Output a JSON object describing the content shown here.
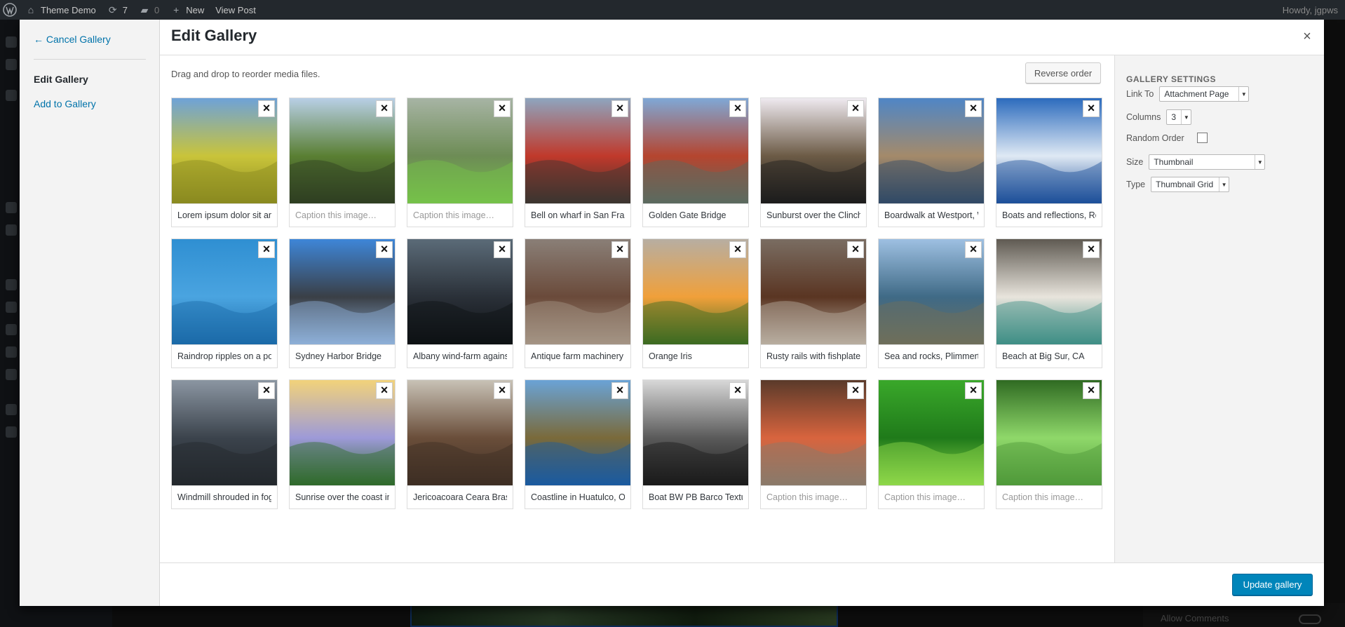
{
  "adminbar": {
    "site_name": "Theme Demo",
    "updates_count": "7",
    "comments_count": "0",
    "new_label": "New",
    "view_post_label": "View Post",
    "howdy": "Howdy, jgpws"
  },
  "background": {
    "allow_comments_label": "Allow Comments"
  },
  "menu": {
    "cancel_label": "← Cancel Gallery",
    "edit_gallery_label": "Edit Gallery",
    "add_to_gallery_label": "Add to Gallery"
  },
  "header": {
    "title": "Edit Gallery",
    "close_label": "×"
  },
  "toolbar": {
    "hint": "Drag and drop to reorder media files.",
    "reverse_label": "Reverse order"
  },
  "caption_placeholder": "Caption this image…",
  "items": [
    {
      "caption": "Lorem ipsum dolor sit amet",
      "colors": [
        "#6ea2d8",
        "#c9c43a",
        "#8a8a20"
      ]
    },
    {
      "caption": "",
      "colors": [
        "#b8cfe6",
        "#5a7f33",
        "#2f3f22"
      ]
    },
    {
      "caption": "",
      "colors": [
        "#a7b4a4",
        "#6d8c55",
        "#76c24a"
      ]
    },
    {
      "caption": "Bell on wharf in San Francisco",
      "colors": [
        "#8ea5bf",
        "#c0392b",
        "#3b3530"
      ]
    },
    {
      "caption": "Golden Gate Bridge",
      "colors": [
        "#7fa8d6",
        "#b5452f",
        "#5b6b60"
      ]
    },
    {
      "caption": "Sunburst over the Clinch River",
      "colors": [
        "#efeaf0",
        "#6c5b46",
        "#1c1c1c"
      ]
    },
    {
      "caption": "Boardwalk at Westport, WA",
      "colors": [
        "#4f86c6",
        "#a48a6a",
        "#304a66"
      ]
    },
    {
      "caption": "Boats and reflections, Royal Quays",
      "colors": [
        "#2c6bbd",
        "#dfe9f4",
        "#1d4f9a"
      ]
    },
    {
      "caption": "Raindrop ripples on a pond",
      "colors": [
        "#2f8fd2",
        "#4aa4e0",
        "#1b6aa8"
      ]
    },
    {
      "caption": "Sydney Harbor Bridge",
      "colors": [
        "#3e86d8",
        "#3a3f46",
        "#8db0d8"
      ]
    },
    {
      "caption": "Albany wind-farm against the sky",
      "colors": [
        "#5b6b78",
        "#2a3038",
        "#0e1114"
      ]
    },
    {
      "caption": "Antique farm machinery",
      "colors": [
        "#8a7f77",
        "#6a4a3a",
        "#a49484"
      ]
    },
    {
      "caption": "Orange Iris",
      "colors": [
        "#b7aea2",
        "#f0a03a",
        "#3b6b22"
      ]
    },
    {
      "caption": "Rusty rails with fishplate",
      "colors": [
        "#7a6d62",
        "#5a3522",
        "#b8aea0"
      ]
    },
    {
      "caption": "Sea and rocks, Plimmerton",
      "colors": [
        "#9ec0e2",
        "#3f6a86",
        "#6e6e5a"
      ]
    },
    {
      "caption": "Beach at Big Sur, CA",
      "colors": [
        "#5f5a52",
        "#e8e4dc",
        "#3f8f86"
      ]
    },
    {
      "caption": "Windmill shrouded in fog",
      "colors": [
        "#8b96a2",
        "#3b434c",
        "#23282d"
      ]
    },
    {
      "caption": "Sunrise over the coast in Australia",
      "colors": [
        "#f2d27a",
        "#9d9ad8",
        "#2f6a2a"
      ]
    },
    {
      "caption": "Jericoacoara Ceara Brasil",
      "colors": [
        "#c8c2b6",
        "#6a4e3a",
        "#3d2e24"
      ]
    },
    {
      "caption": "Coastline in Huatulco, Oaxaca",
      "colors": [
        "#6aa3d6",
        "#7a6a3a",
        "#1a5aa0"
      ]
    },
    {
      "caption": "Boat BW PB Barco Texture",
      "colors": [
        "#d8d8d8",
        "#5a5a5a",
        "#1a1a1a"
      ]
    },
    {
      "caption": "",
      "colors": [
        "#5a3a2a",
        "#d8643e",
        "#8a7a6a"
      ]
    },
    {
      "caption": "",
      "colors": [
        "#3aa82a",
        "#1f7a1a",
        "#8fd84a"
      ]
    },
    {
      "caption": "",
      "colors": [
        "#2f6a22",
        "#8fd86a",
        "#4f9a3a"
      ]
    }
  ],
  "settings": {
    "heading": "GALLERY SETTINGS",
    "link_to_label": "Link To",
    "link_to_value": "Attachment Page",
    "columns_label": "Columns",
    "columns_value": "3",
    "random_order_label": "Random Order",
    "random_order_checked": false,
    "size_label": "Size",
    "size_value": "Thumbnail",
    "type_label": "Type",
    "type_value": "Thumbnail Grid"
  },
  "footer": {
    "update_label": "Update gallery"
  }
}
